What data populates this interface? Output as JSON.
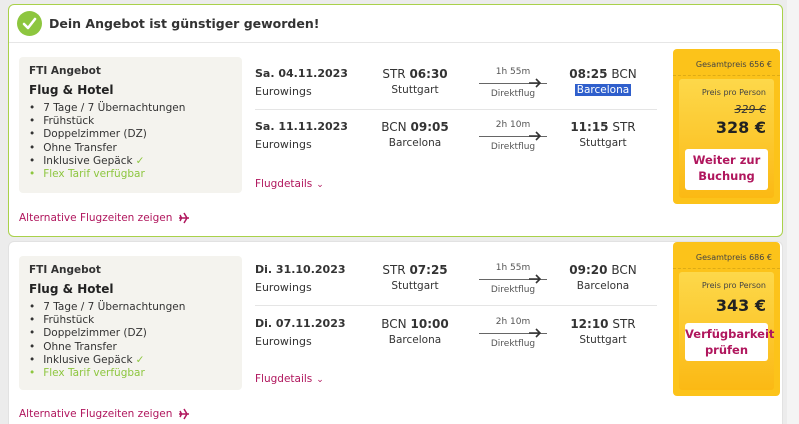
{
  "banner": {
    "text": "Dein Angebot ist günstiger geworden!"
  },
  "offers": [
    {
      "label": "FTI Angebot",
      "title": "Flug & Hotel",
      "features": [
        "7 Tage / 7 Übernachtungen",
        "Frühstück",
        "Doppelzimmer (DZ)",
        "Ohne Transfer",
        "Inklusive Gepäck"
      ],
      "flex": "Flex Tarif verfügbar",
      "outbound": {
        "date": "Sa. 04.11.2023",
        "airline": "Eurowings",
        "dep_code": "STR",
        "dep_time": "06:30",
        "dep_city": "Stuttgart",
        "duration": "1h 55m",
        "type": "Direktflug",
        "arr_time": "08:25",
        "arr_code": "BCN",
        "arr_city": "Barcelona"
      },
      "inbound": {
        "date": "Sa. 11.11.2023",
        "airline": "Eurowings",
        "dep_code": "BCN",
        "dep_time": "09:05",
        "dep_city": "Barcelona",
        "duration": "2h 10m",
        "type": "Direktflug",
        "arr_time": "11:15",
        "arr_code": "STR",
        "arr_city": "Stuttgart"
      },
      "details_label": "Flugdetails",
      "alt_label": "Alternative Flugzeiten zeigen",
      "total": "Gesamtpreis 656 €",
      "per_person_label": "Preis pro Person",
      "old_price": "329 €",
      "price": "328 €",
      "button": "Weiter zur Buchung"
    },
    {
      "label": "FTI Angebot",
      "title": "Flug & Hotel",
      "features": [
        "7 Tage / 7 Übernachtungen",
        "Frühstück",
        "Doppelzimmer (DZ)",
        "Ohne Transfer",
        "Inklusive Gepäck"
      ],
      "flex": "Flex Tarif verfügbar",
      "outbound": {
        "date": "Di. 31.10.2023",
        "airline": "Eurowings",
        "dep_code": "STR",
        "dep_time": "07:25",
        "dep_city": "Stuttgart",
        "duration": "1h 55m",
        "type": "Direktflug",
        "arr_time": "09:20",
        "arr_code": "BCN",
        "arr_city": "Barcelona"
      },
      "inbound": {
        "date": "Di. 07.11.2023",
        "airline": "Eurowings",
        "dep_code": "BCN",
        "dep_time": "10:00",
        "dep_city": "Barcelona",
        "duration": "2h 10m",
        "type": "Direktflug",
        "arr_time": "12:10",
        "arr_code": "STR",
        "arr_city": "Stuttgart"
      },
      "details_label": "Flugdetails",
      "alt_label": "Alternative Flugzeiten zeigen",
      "total": "Gesamtpreis 686 €",
      "per_person_label": "Preis pro Person",
      "price": "343 €",
      "button": "Verfügbarkeit prüfen"
    }
  ],
  "colors": {
    "accent_green": "#8dc63f",
    "link_magenta": "#b0165d",
    "price_yellow": "#fcc31a"
  }
}
